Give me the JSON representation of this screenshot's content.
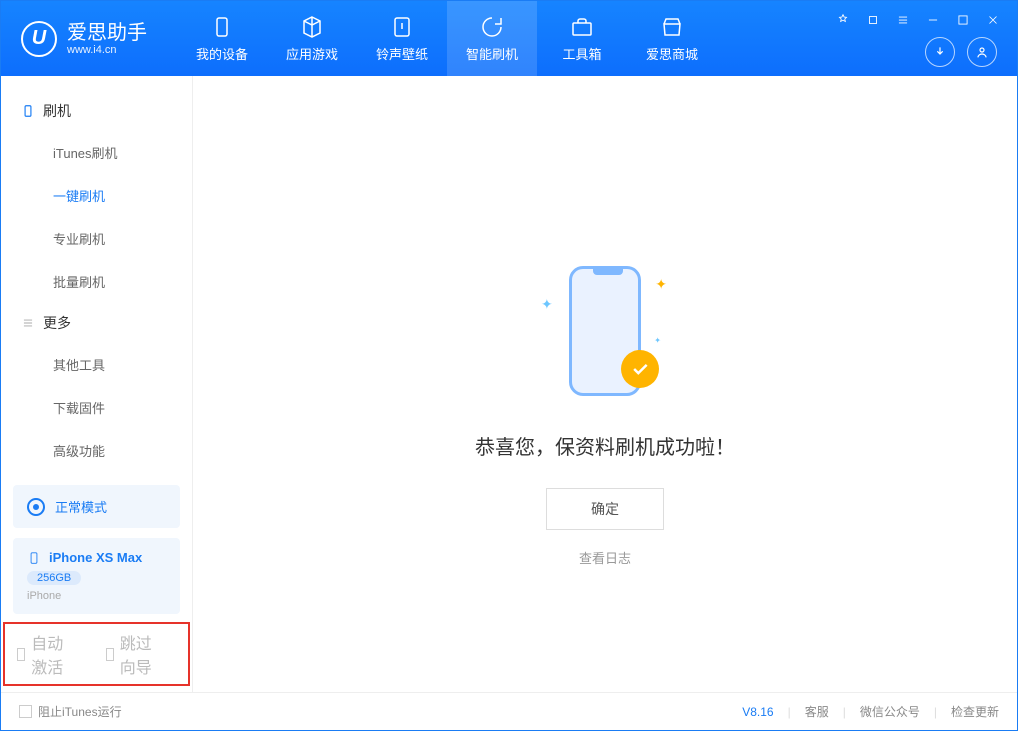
{
  "brand": {
    "title": "爱思助手",
    "subtitle": "www.i4.cn"
  },
  "nav": {
    "items": [
      {
        "label": "我的设备"
      },
      {
        "label": "应用游戏"
      },
      {
        "label": "铃声壁纸"
      },
      {
        "label": "智能刷机"
      },
      {
        "label": "工具箱"
      },
      {
        "label": "爱思商城"
      }
    ]
  },
  "sidebar": {
    "section1_title": "刷机",
    "section1_items": [
      "iTunes刷机",
      "一键刷机",
      "专业刷机",
      "批量刷机"
    ],
    "section2_title": "更多",
    "section2_items": [
      "其他工具",
      "下载固件",
      "高级功能"
    ]
  },
  "mode_label": "正常模式",
  "device": {
    "name": "iPhone XS Max",
    "capacity": "256GB",
    "type": "iPhone"
  },
  "main": {
    "success_text": "恭喜您，保资料刷机成功啦！",
    "confirm_label": "确定",
    "log_link": "查看日志"
  },
  "options": {
    "auto_activate": "自动激活",
    "skip_guide": "跳过向导"
  },
  "footer": {
    "block_itunes": "阻止iTunes运行",
    "version": "V8.16",
    "links": [
      "客服",
      "微信公众号",
      "检查更新"
    ]
  }
}
